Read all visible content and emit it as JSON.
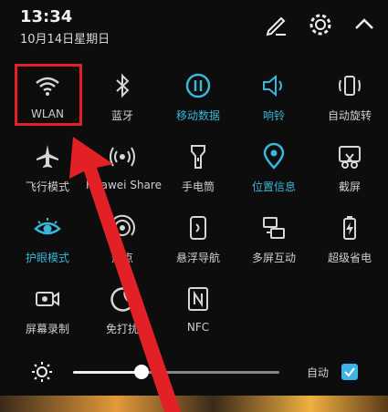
{
  "status": {
    "time": "13:34",
    "date": "10月14日星期日"
  },
  "colors": {
    "active": "#39b6d9",
    "highlight": "#e32026",
    "checkbox": "#3fb3e6"
  },
  "tiles": [
    {
      "label": "WLAN",
      "icon": "wifi-icon",
      "active": false
    },
    {
      "label": "蓝牙",
      "icon": "bluetooth-icon",
      "active": false
    },
    {
      "label": "移动数据",
      "icon": "mobile-data-icon",
      "active": true
    },
    {
      "label": "响铃",
      "icon": "speaker-icon",
      "active": true
    },
    {
      "label": "自动旋转",
      "icon": "auto-rotate-icon",
      "active": false
    },
    {
      "label": "飞行模式",
      "icon": "airplane-icon",
      "active": false
    },
    {
      "label": "Huawei Share",
      "icon": "huawei-share-icon",
      "active": false
    },
    {
      "label": "手电筒",
      "icon": "flashlight-icon",
      "active": false
    },
    {
      "label": "位置信息",
      "icon": "location-icon",
      "active": true
    },
    {
      "label": "截屏",
      "icon": "screenshot-icon",
      "active": false
    },
    {
      "label": "护眼模式",
      "icon": "eye-icon",
      "active": true
    },
    {
      "label": "热点",
      "icon": "hotspot-icon",
      "active": false
    },
    {
      "label": "悬浮导航",
      "icon": "floating-nav-icon",
      "active": false
    },
    {
      "label": "多屏互动",
      "icon": "multi-screen-icon",
      "active": false
    },
    {
      "label": "超级省电",
      "icon": "battery-saver-icon",
      "active": false
    },
    {
      "label": "屏幕录制",
      "icon": "screen-record-icon",
      "active": false
    },
    {
      "label": "免打扰",
      "icon": "moon-icon",
      "active": false
    },
    {
      "label": "NFC",
      "icon": "nfc-icon",
      "active": false
    }
  ],
  "brightness": {
    "level": 0.33,
    "auto_label": "自动",
    "auto_checked": true
  }
}
